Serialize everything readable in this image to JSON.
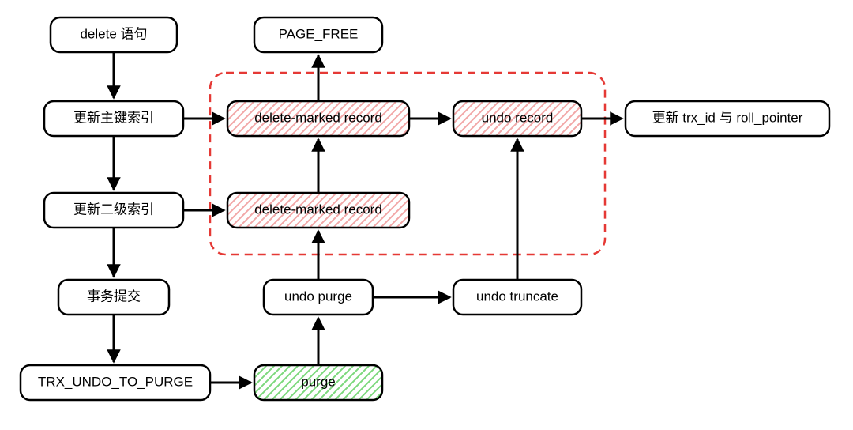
{
  "diagram": {
    "nodes": {
      "delete_stmt": "delete 语句",
      "update_pk": "更新主键索引",
      "update_sec": "更新二级索引",
      "commit": "事务提交",
      "trx_undo_to_purge": "TRX_UNDO_TO_PURGE",
      "page_free": "PAGE_FREE",
      "dm_record_top": "delete-marked record",
      "dm_record_bot": "delete-marked record",
      "undo_record": "undo record",
      "update_trx": "更新 trx_id 与 roll_pointer",
      "undo_purge": "undo purge",
      "undo_truncate": "undo truncate",
      "purge": "purge"
    },
    "colors": {
      "hatch_pink": "#f2a7a7",
      "hatch_green": "#7cd87c",
      "dashed_red": "#e53935"
    }
  }
}
